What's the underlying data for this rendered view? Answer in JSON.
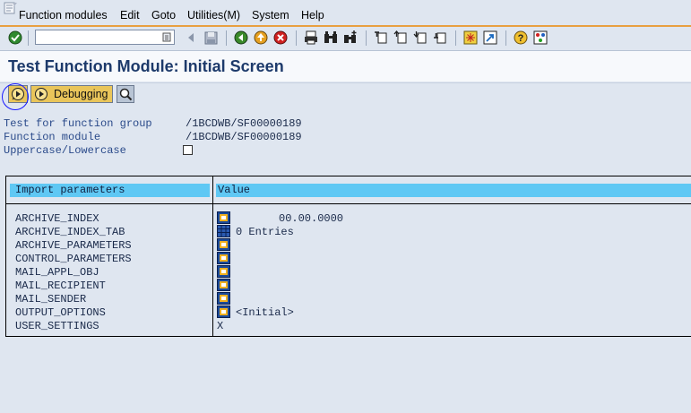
{
  "menu": {
    "items": [
      "Function modules",
      "Edit",
      "Goto",
      "Utilities(M)",
      "System",
      "Help"
    ]
  },
  "toolbar": {
    "command_value": ""
  },
  "page": {
    "title": "Test Function Module: Initial Screen"
  },
  "app_toolbar": {
    "debugging_label": "Debugging"
  },
  "fields": {
    "function_group_label": "Test for function group",
    "function_group_value": "/1BCDWB/SF00000189",
    "function_module_label": "Function module",
    "function_module_value": "/1BCDWB/SF00000189",
    "case_label": "Uppercase/Lowercase"
  },
  "table": {
    "col_param": "Import parameters",
    "col_value": "Value",
    "rows": [
      {
        "name": "ARCHIVE_INDEX",
        "icon": "value-help-icon",
        "value": "00.00.0000"
      },
      {
        "name": "ARCHIVE_INDEX_TAB",
        "icon": "table-entries-icon",
        "value": "0 Entries"
      },
      {
        "name": "ARCHIVE_PARAMETERS",
        "icon": "value-help-icon",
        "value": ""
      },
      {
        "name": "CONTROL_PARAMETERS",
        "icon": "value-help-icon",
        "value": ""
      },
      {
        "name": "MAIL_APPL_OBJ",
        "icon": "value-help-icon",
        "value": ""
      },
      {
        "name": "MAIL_RECIPIENT",
        "icon": "value-help-icon",
        "value": ""
      },
      {
        "name": "MAIL_SENDER",
        "icon": "value-help-icon",
        "value": ""
      },
      {
        "name": "OUTPUT_OPTIONS",
        "icon": "value-help-icon",
        "value": "<Initial>"
      },
      {
        "name": "USER_SETTINGS",
        "icon": "",
        "value": "X"
      }
    ]
  },
  "colors": {
    "title": "#1d3a6b",
    "header_fill": "#5fc8f4",
    "button_fill": "#e9c55a",
    "label": "#2a4a8a",
    "background": "#dfe6f0"
  }
}
